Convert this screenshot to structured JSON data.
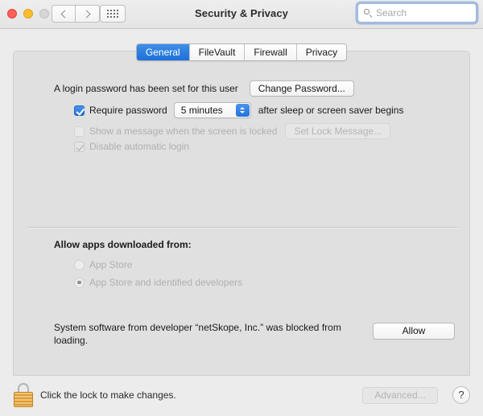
{
  "window": {
    "title": "Security & Privacy",
    "traffic_lights": [
      "close",
      "minimize",
      "zoom-disabled"
    ],
    "nav": {
      "back": "back-chevron",
      "forward": "forward-chevron",
      "show_all": "grid-icon"
    }
  },
  "search": {
    "placeholder": "Search",
    "value": "",
    "icon": "search-icon"
  },
  "tabs": [
    {
      "label": "General",
      "active": true
    },
    {
      "label": "FileVault",
      "active": false
    },
    {
      "label": "Firewall",
      "active": false
    },
    {
      "label": "Privacy",
      "active": false
    }
  ],
  "general": {
    "login_password_text": "A login password has been set for this user",
    "change_password_button": "Change Password...",
    "require_password": {
      "label": "Require password",
      "checked": true,
      "delay_value": "5 minutes",
      "suffix": "after sleep or screen saver begins"
    },
    "show_message": {
      "label": "Show a message when the screen is locked",
      "checked": false,
      "enabled": false,
      "button": "Set Lock Message..."
    },
    "disable_auto_login": {
      "label": "Disable automatic login",
      "checked": true,
      "enabled": false
    },
    "allow_apps": {
      "title": "Allow apps downloaded from:",
      "options": [
        {
          "label": "App Store",
          "selected": false
        },
        {
          "label": "App Store and identified developers",
          "selected": true
        }
      ]
    },
    "blocked_software": {
      "message": "System software from developer “netSkope, Inc.” was blocked from loading.",
      "allow_button": "Allow"
    }
  },
  "bottom": {
    "lock_icon": "lock-closed-icon",
    "lock_caption": "Click the lock to make changes.",
    "advanced_button": "Advanced...",
    "help_button": "?"
  },
  "colors": {
    "accent_blue": "#2173dd",
    "window_bg": "#ececec",
    "panel_bg": "#e0e0e0",
    "lock_gold": "#e8a437"
  }
}
